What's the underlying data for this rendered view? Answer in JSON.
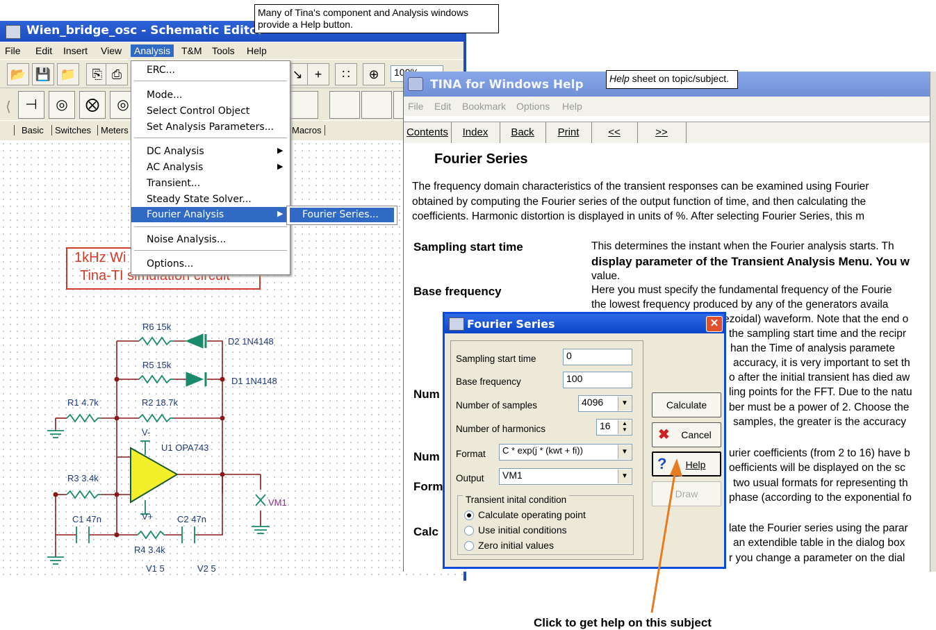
{
  "callout_top": "Many of Tina's component  and  Analysis windows provide a Help button.",
  "callout_help": {
    "em": "Help",
    "rest": " sheet on topic/subject."
  },
  "footer": "Click to get help on this subject",
  "editor": {
    "title": "Wien_bridge_osc - Schematic Editor",
    "menu": [
      "File",
      "Edit",
      "Insert",
      "View",
      "Analysis",
      "T&M",
      "Tools",
      "Help"
    ],
    "zoom": "100%",
    "tabs": [
      "Basic",
      "Switches",
      "Meters",
      "Macros"
    ],
    "canvas_title": [
      "1kHz Wi",
      "Tina-TI simulation circuit"
    ],
    "labels": {
      "r6": "R6 15k",
      "d2": "D2 1N4148",
      "r5": "R5 15k",
      "d1": "D1 1N4148",
      "r1": "R1 4.7k",
      "r2": "R2 18.7k",
      "vminus": "V-",
      "u1": "U1 OPA743",
      "r3": "R3 3.4k",
      "vplus": "V+",
      "c1": "C1 47n",
      "c2": "C2 47n",
      "r4": "R4 3.4k",
      "vm1": "VM1",
      "v1": "V1 5",
      "v2": "V2 5"
    }
  },
  "analysis_menu": {
    "items": [
      "ERC...",
      "Mode...",
      "Select Control Object",
      "Set Analysis Parameters...",
      "DC Analysis",
      "AC Analysis",
      "Transient...",
      "Steady State Solver...",
      "Fourier Analysis",
      "Noise Analysis...",
      "Options..."
    ],
    "submenu": "Fourier Series..."
  },
  "help": {
    "title": "TINA for Windows Help",
    "menu": [
      "File",
      "Edit",
      "Bookmark",
      "Options",
      "Help"
    ],
    "buttons": [
      "Contents",
      "Index",
      "Back",
      "Print",
      "<<",
      ">>"
    ],
    "heading": "Fourier Series",
    "intro": [
      "The frequency domain characteristics of the transient responses can be examined using Fourier",
      "obtained by computing the Fourier series of the output function of time, and then calculating the",
      "coefficients. Harmonic distortion is displayed in units of %. After selecting Fourier Series, this m"
    ],
    "terms": [
      "Sampling start time",
      "Base frequency",
      "Num",
      "Num",
      "Form",
      "Calc"
    ],
    "desc": [
      "This determines the instant when the Fourier analysis starts. Th",
      "display parameter of the Transient Analysis Menu. You w",
      "value.",
      "Here you must specify the fundamental frequency of the Fourie",
      "the lowest frequency produced by any of the generators availa",
      "ezoidal) waveform. Note that the end o",
      "the sampling start time and the recipr",
      "han the Time of analysis paramete",
      "accuracy, it is very important to set th",
      "o after the initial transient has died aw",
      "ling points for the FFT. Due to the natu",
      "ber must be a power of 2. Choose the",
      "samples, the greater is the accuracy",
      "urier coefficients (from 2 to 16) have b",
      "oefficients will be displayed on the sc",
      "two usual formats for representing th",
      "phase (according to the exponential fo",
      "late the Fourier series using the parar",
      "an extendible table in the dialog box",
      "r you change a parameter on the dial"
    ]
  },
  "dialog": {
    "title": "Fourier Series",
    "sampling_label": "Sampling start time",
    "sampling_value": "0",
    "base_label": "Base frequency",
    "base_value": "100",
    "samples_label": "Number of samples",
    "samples_value": "4096",
    "harmonics_label": "Number of harmonics",
    "harmonics_value": "16",
    "format_label": "Format",
    "format_value": "C * exp(j * (kwt + fi))",
    "output_label": "Output",
    "output_value": "VM1",
    "group_label": "Transient inital condition",
    "radios": [
      "Calculate operating point",
      "Use initial conditions",
      "Zero initial values"
    ],
    "selected_radio": 0,
    "buttons": {
      "calculate": "Calculate",
      "cancel": "Cancel",
      "help": "Help",
      "draw": "Draw"
    }
  },
  "colors": {
    "accent": "#316ac5",
    "arrow": "#e87a22",
    "title_red": "#d23a2a",
    "wire_green": "#1a8a6a"
  }
}
